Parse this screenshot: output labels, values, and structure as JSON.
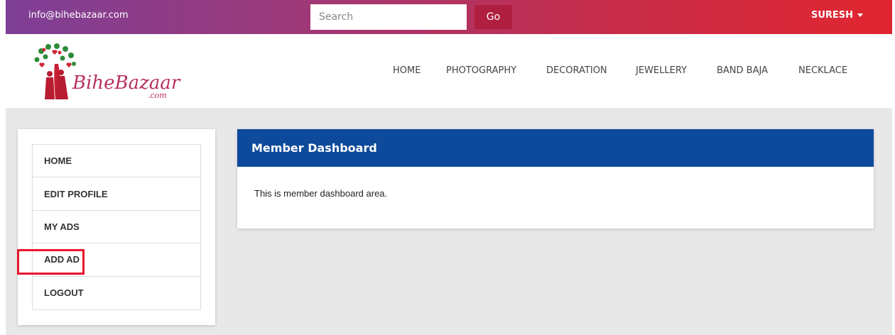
{
  "topbar": {
    "email": "info@bihebazaar.com",
    "search_placeholder": "Search",
    "go_label": "Go",
    "user_label": "SURESH"
  },
  "logo": {
    "text": "BiheBazaar",
    "sub": ".com"
  },
  "nav": {
    "items": [
      {
        "label": "HOME"
      },
      {
        "label": "PHOTOGRAPHY"
      },
      {
        "label": "DECORATION"
      },
      {
        "label": "JEWELLERY"
      },
      {
        "label": "BAND BAJA"
      },
      {
        "label": "NECKLACE"
      }
    ]
  },
  "sidebar": {
    "items": [
      {
        "label": "HOME"
      },
      {
        "label": "EDIT PROFILE"
      },
      {
        "label": "MY ADS"
      },
      {
        "label": "ADD AD"
      },
      {
        "label": "LOGOUT"
      }
    ]
  },
  "panel": {
    "title": "Member Dashboard",
    "body": "This is member dashboard area."
  },
  "colors": {
    "topbar_start": "#7e3f96",
    "topbar_end": "#e1262f",
    "panel_header": "#0d4a9b",
    "highlight": "#e8172e",
    "page_bg": "#e8e8e8"
  }
}
